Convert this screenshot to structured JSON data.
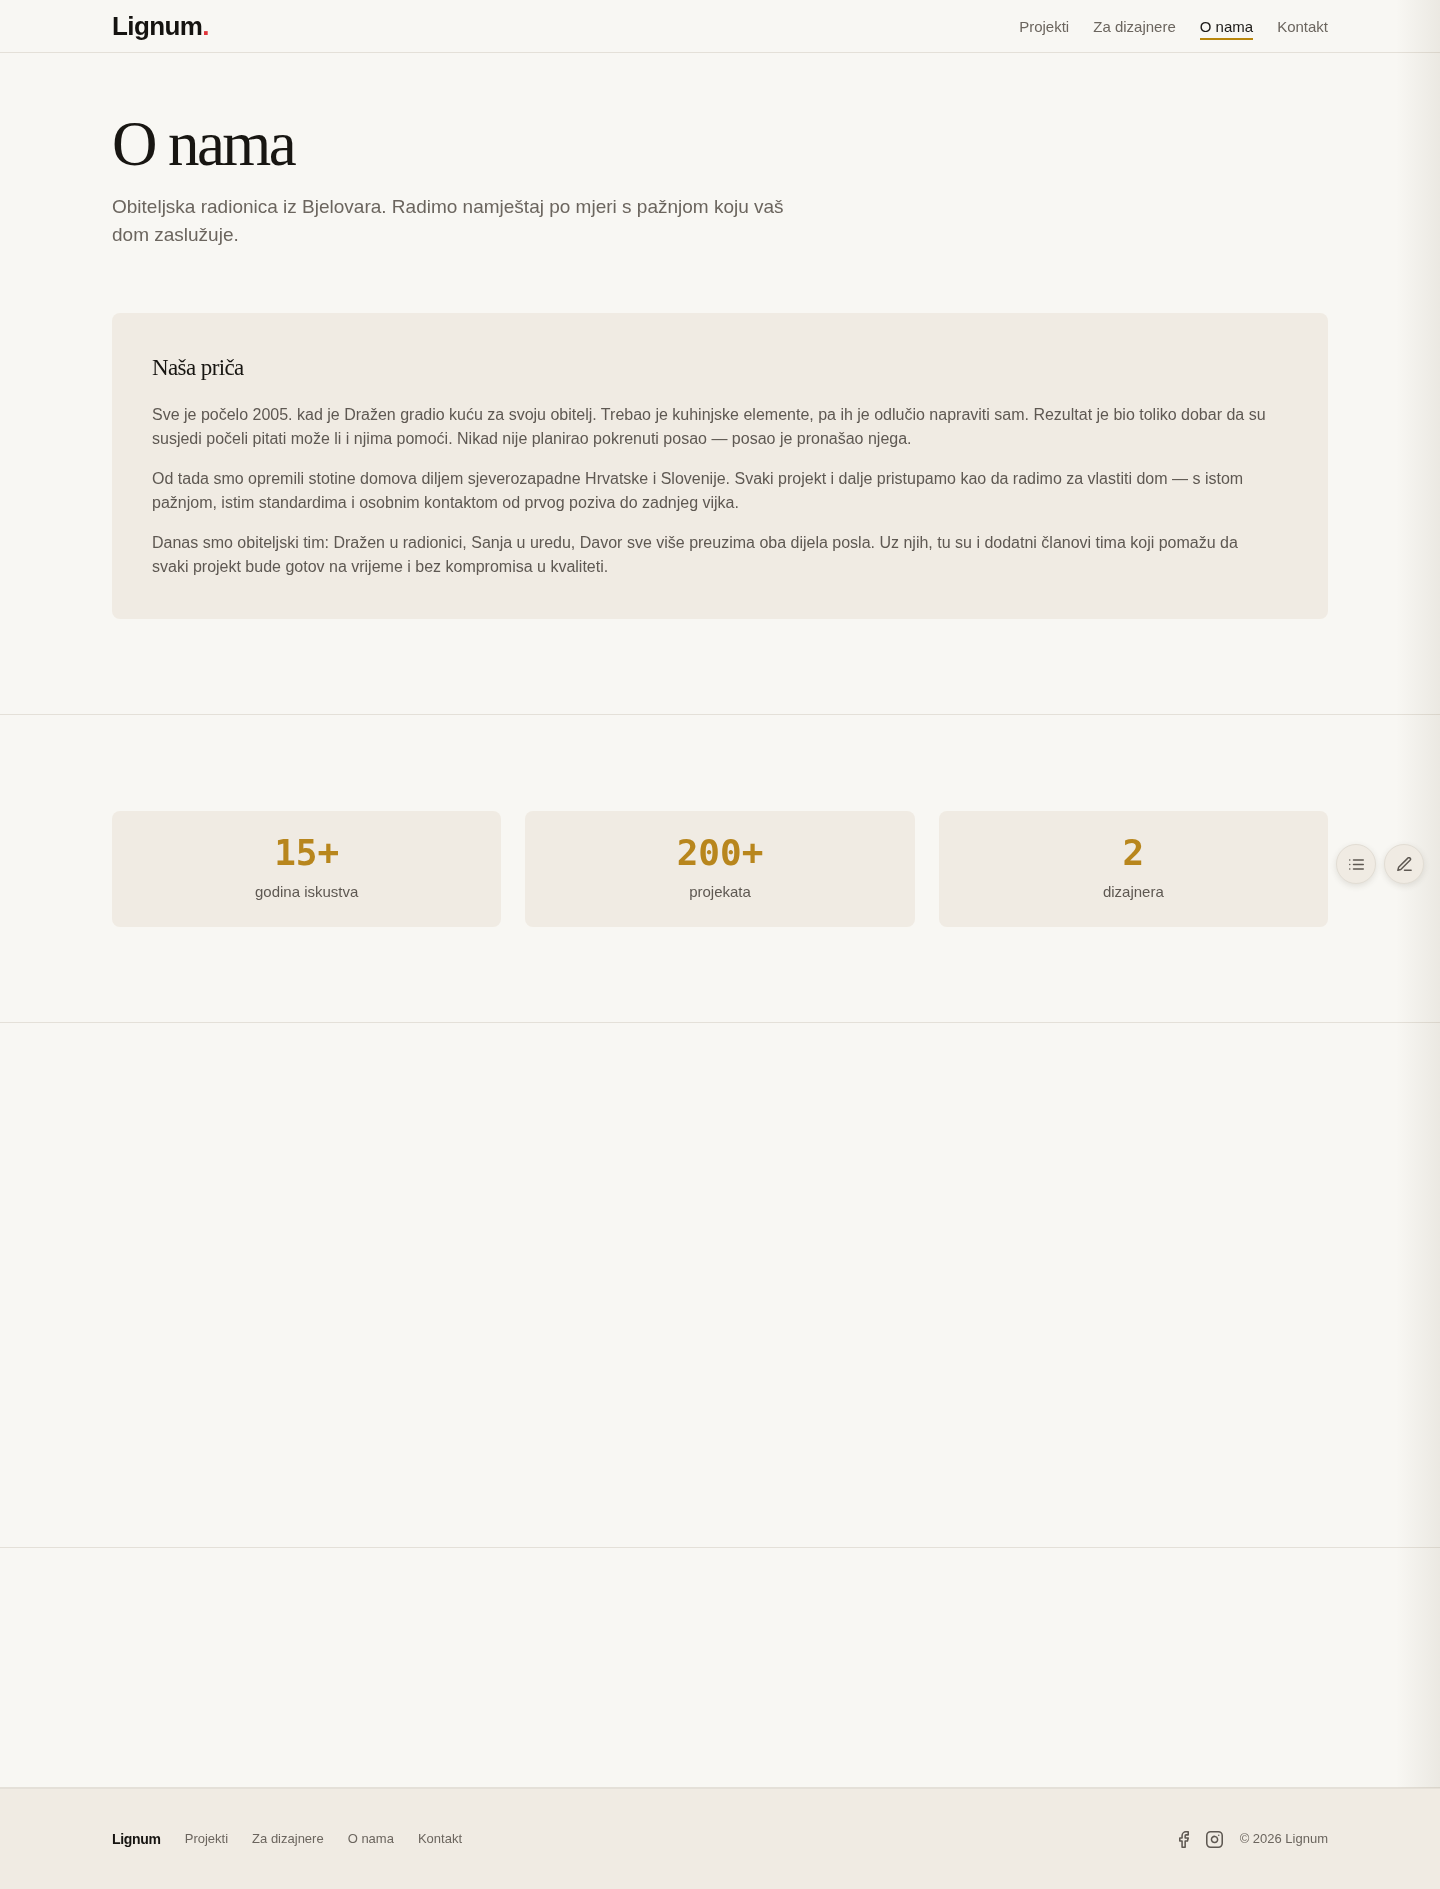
{
  "header": {
    "logo": {
      "name": "Lignum",
      "mark": "."
    },
    "nav": [
      {
        "label": "Projekti",
        "selected": false
      },
      {
        "label": "Za dizajnere",
        "selected": false
      },
      {
        "label": "O nama",
        "selected": true
      },
      {
        "label": "Kontakt",
        "selected": false
      }
    ]
  },
  "hero": {
    "title": "O nama",
    "subtitle": "Obiteljska radionica iz Bjelovara. Radimo namještaj po mjeri s pažnjom koju vaš dom zaslužuje."
  },
  "story": {
    "title": "Naša priča",
    "paragraphs": [
      "Sve je počelo 2005. kad je Dražen gradio kuću za svoju obitelj. Trebao je kuhinjske elemente, pa ih je odlučio napraviti sam. Rezultat je bio toliko dobar da su susjedi počeli pitati može li i njima pomoći. Nikad nije planirao pokrenuti posao — posao je pronašao njega.",
      "Od tada smo opremili stotine domova diljem sjeverozapadne Hrvatske i Slovenije. Svaki projekt i dalje pristupamo kao da radimo za vlastiti dom — s istom pažnjom, istim standardima i osobnim kontaktom od prvog poziva do zadnjeg vijka.",
      "Danas smo obiteljski tim: Dražen u radionici, Sanja u uredu, Davor sve više preuzima oba dijela posla. Uz njih, tu su i dodatni članovi tima koji pomažu da svaki projekt bude gotov na vrijeme i bez kompromisa u kvaliteti."
    ]
  },
  "stats": [
    {
      "value": "15+",
      "label": "godina iskustva"
    },
    {
      "value": "200+",
      "label": "projekata"
    },
    {
      "value": "2",
      "label": "dizajnera"
    }
  ],
  "floating_buttons": [
    {
      "kind": "list"
    },
    {
      "kind": "edit"
    }
  ],
  "footer": {
    "logo": "Lignum",
    "links": [
      "Projekti",
      "Za dizajnere",
      "O nama",
      "Kontakt"
    ],
    "social": [
      {
        "kind": "facebook"
      },
      {
        "kind": "instagram"
      }
    ],
    "copyright": "© 2026 Lignum"
  }
}
